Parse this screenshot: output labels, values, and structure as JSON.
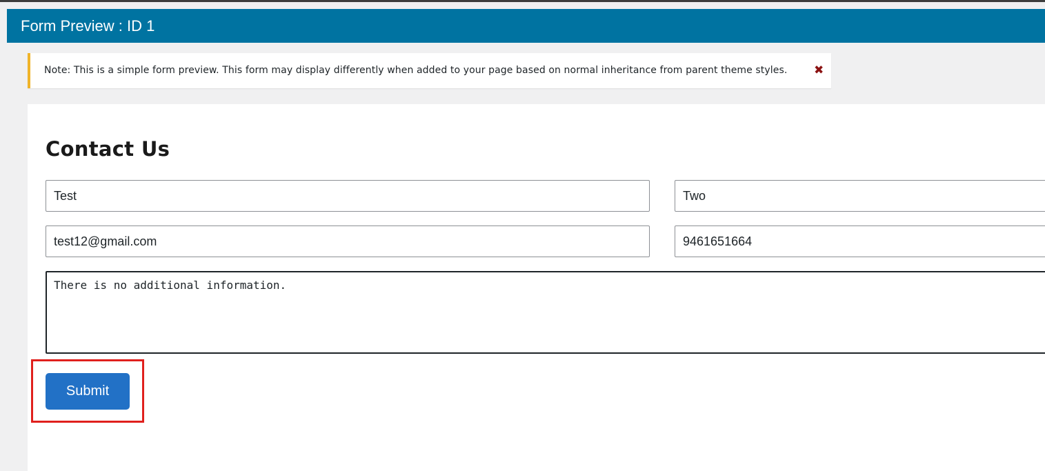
{
  "window": {
    "title": "Form Preview : ID 1"
  },
  "notice": {
    "text": "Note: This is a simple form preview. This form may display differently when added to your page based on normal inheritance from parent theme styles.",
    "close_glyph": "✖",
    "close_icon": "close-icon",
    "accent_color": "#f0b429"
  },
  "form": {
    "heading": "Contact Us",
    "fields": {
      "first_name": {
        "value": "Test"
      },
      "last_name": {
        "value": "Two"
      },
      "email": {
        "value": "test12@gmail.com"
      },
      "phone": {
        "value": "9461651664"
      },
      "message": {
        "value": "There is no additional information."
      }
    },
    "submit_label": "Submit"
  },
  "colors": {
    "title_bar": "#0073a1",
    "submit_button": "#2271c6",
    "highlight": "#e0201d"
  }
}
